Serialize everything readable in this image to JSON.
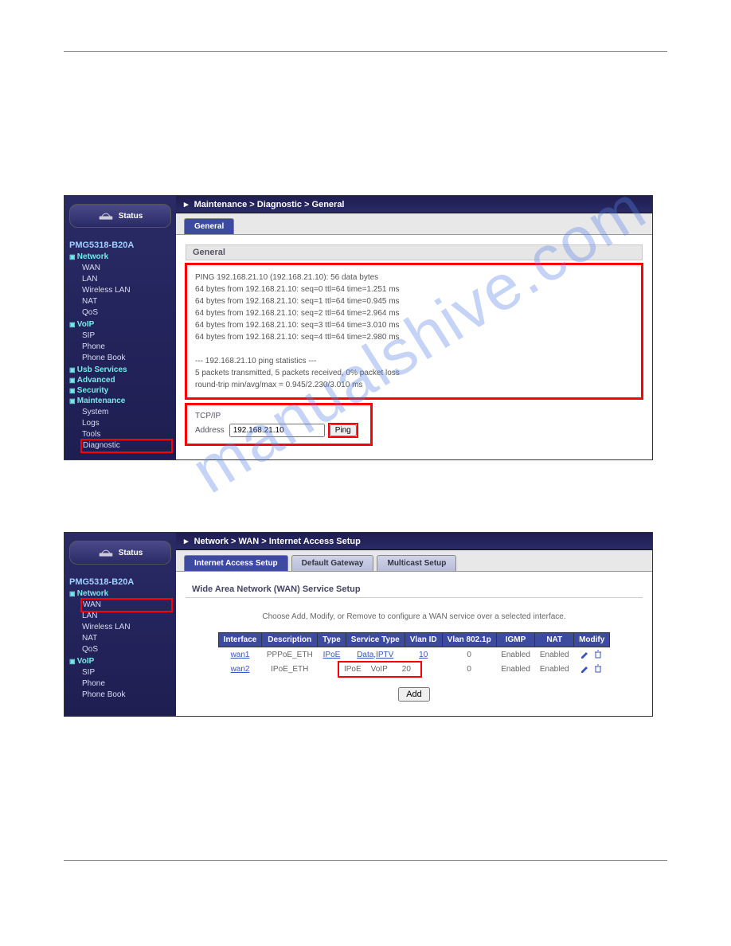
{
  "watermark": "manualshive.com",
  "ui1": {
    "status_button": "Status",
    "device": "PMG5318-B20A",
    "breadcrumb": "Maintenance > Diagnostic > General",
    "tab_general": "General",
    "panel_title": "General",
    "ping_output": "PING 192.168.21.10 (192.168.21.10): 56 data bytes\n64 bytes from 192.168.21.10: seq=0 ttl=64 time=1.251 ms\n64 bytes from 192.168.21.10: seq=1 ttl=64 time=0.945 ms\n64 bytes from 192.168.21.10: seq=2 ttl=64 time=2.964 ms\n64 bytes from 192.168.21.10: seq=3 ttl=64 time=3.010 ms\n64 bytes from 192.168.21.10: seq=4 ttl=64 time=2.980 ms\n\n--- 192.168.21.10 ping statistics ---\n5 packets transmitted, 5 packets received, 0% packet loss\nround-trip min/avg/max = 0.945/2.230/3.010 ms",
    "tcpip_label": "TCP/IP",
    "address_label": "Address",
    "address_value": "192.168.21.10",
    "ping_btn": "Ping",
    "tree": {
      "network": "Network",
      "wan": "WAN",
      "lan": "LAN",
      "wlan": "Wireless LAN",
      "nat": "NAT",
      "qos": "QoS",
      "voip": "VoIP",
      "sip": "SIP",
      "phone": "Phone",
      "phonebook": "Phone Book",
      "usb": "Usb Services",
      "advanced": "Advanced",
      "security": "Security",
      "maintenance": "Maintenance",
      "system": "System",
      "logs": "Logs",
      "tools": "Tools",
      "diagnostic": "Diagnostic"
    }
  },
  "ui2": {
    "status_button": "Status",
    "device": "PMG5318-B20A",
    "breadcrumb": "Network > WAN > Internet Access Setup",
    "tabs": {
      "ias": "Internet Access Setup",
      "gw": "Default Gateway",
      "mc": "Multicast Setup"
    },
    "panel_title": "Wide Area Network (WAN) Service Setup",
    "desc": "Choose Add, Modify, or Remove to configure a WAN service over a selected interface.",
    "add": "Add",
    "headers": {
      "iface": "Interface",
      "desc": "Description",
      "type": "Type",
      "svc": "Service Type",
      "vlan": "Vlan ID",
      "v1p": "Vlan 802.1p",
      "igmp": "IGMP",
      "nat": "NAT",
      "mod": "Modify"
    },
    "rows": [
      {
        "iface": "wan1",
        "desc": "PPPoE_ETH",
        "type": "IPoE",
        "svc": "Data,IPTV",
        "vlan": "10",
        "v1p": "0",
        "igmp": "Enabled",
        "nat": "Enabled"
      },
      {
        "iface": "wan2",
        "desc": "IPoE_ETH",
        "type": "IPoE",
        "svc": "VoIP",
        "vlan": "20",
        "v1p": "0",
        "igmp": "Enabled",
        "nat": "Enabled"
      }
    ],
    "tree": {
      "network": "Network",
      "wan": "WAN",
      "lan": "LAN",
      "wlan": "Wireless LAN",
      "nat": "NAT",
      "qos": "QoS",
      "voip": "VoIP",
      "sip": "SIP",
      "phone": "Phone",
      "phonebook": "Phone Book"
    }
  }
}
